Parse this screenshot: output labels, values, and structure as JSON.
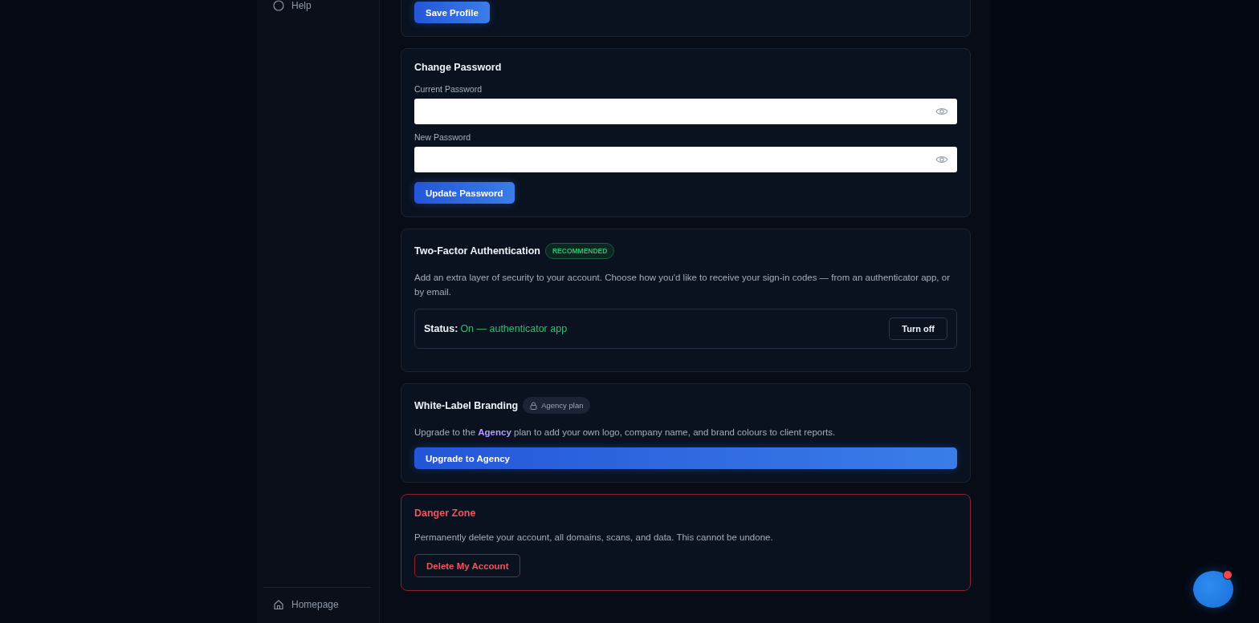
{
  "sidebar": {
    "items": [
      {
        "label": "Help",
        "kind": "help"
      }
    ],
    "footer_items": [
      {
        "label": "Homepage",
        "kind": "home"
      }
    ]
  },
  "profile": {
    "save_button": "Save Profile"
  },
  "change_password": {
    "title": "Change Password",
    "fields": [
      {
        "label": "Current Password"
      },
      {
        "label": "New Password"
      }
    ],
    "button": "Update Password"
  },
  "two_factor": {
    "title": "Two-Factor Authentication",
    "badge": "RECOMMENDED",
    "description": "Add an extra layer of security to your account. Choose how you'd like to receive your sign-in codes — from an authenticator app, or by email.",
    "status_label": "Status:",
    "status_value": "On — authenticator app",
    "on": true,
    "button": "Turn off"
  },
  "branding": {
    "title": "White-Label Branding",
    "badge": "Agency plan",
    "locked": true,
    "description": "Upgrade to the **Agency** plan to add your own logo, company name, and brand colours to client reports.",
    "button": "Upgrade to Agency"
  },
  "danger_zone": {
    "title": "Danger Zone",
    "description": "Permanently delete your account, all domains, scans, and data. This cannot be undone.",
    "button": "Delete My Account"
  },
  "chat_widget": {
    "notification": true
  }
}
